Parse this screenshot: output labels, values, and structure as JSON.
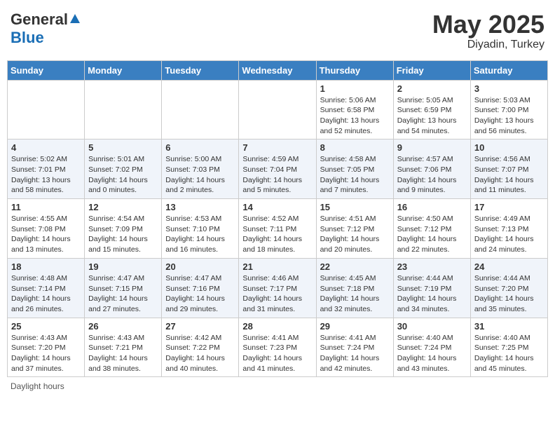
{
  "header": {
    "logo_general": "General",
    "logo_blue": "Blue",
    "month": "May 2025",
    "location": "Diyadin, Turkey"
  },
  "days_of_week": [
    "Sunday",
    "Monday",
    "Tuesday",
    "Wednesday",
    "Thursday",
    "Friday",
    "Saturday"
  ],
  "footer": {
    "daylight_hours": "Daylight hours"
  },
  "weeks": [
    [
      {
        "day": "",
        "sunrise": "",
        "sunset": "",
        "daylight": ""
      },
      {
        "day": "",
        "sunrise": "",
        "sunset": "",
        "daylight": ""
      },
      {
        "day": "",
        "sunrise": "",
        "sunset": "",
        "daylight": ""
      },
      {
        "day": "",
        "sunrise": "",
        "sunset": "",
        "daylight": ""
      },
      {
        "day": "1",
        "sunrise": "Sunrise: 5:06 AM",
        "sunset": "Sunset: 6:58 PM",
        "daylight": "Daylight: 13 hours and 52 minutes."
      },
      {
        "day": "2",
        "sunrise": "Sunrise: 5:05 AM",
        "sunset": "Sunset: 6:59 PM",
        "daylight": "Daylight: 13 hours and 54 minutes."
      },
      {
        "day": "3",
        "sunrise": "Sunrise: 5:03 AM",
        "sunset": "Sunset: 7:00 PM",
        "daylight": "Daylight: 13 hours and 56 minutes."
      }
    ],
    [
      {
        "day": "4",
        "sunrise": "Sunrise: 5:02 AM",
        "sunset": "Sunset: 7:01 PM",
        "daylight": "Daylight: 13 hours and 58 minutes."
      },
      {
        "day": "5",
        "sunrise": "Sunrise: 5:01 AM",
        "sunset": "Sunset: 7:02 PM",
        "daylight": "Daylight: 14 hours and 0 minutes."
      },
      {
        "day": "6",
        "sunrise": "Sunrise: 5:00 AM",
        "sunset": "Sunset: 7:03 PM",
        "daylight": "Daylight: 14 hours and 2 minutes."
      },
      {
        "day": "7",
        "sunrise": "Sunrise: 4:59 AM",
        "sunset": "Sunset: 7:04 PM",
        "daylight": "Daylight: 14 hours and 5 minutes."
      },
      {
        "day": "8",
        "sunrise": "Sunrise: 4:58 AM",
        "sunset": "Sunset: 7:05 PM",
        "daylight": "Daylight: 14 hours and 7 minutes."
      },
      {
        "day": "9",
        "sunrise": "Sunrise: 4:57 AM",
        "sunset": "Sunset: 7:06 PM",
        "daylight": "Daylight: 14 hours and 9 minutes."
      },
      {
        "day": "10",
        "sunrise": "Sunrise: 4:56 AM",
        "sunset": "Sunset: 7:07 PM",
        "daylight": "Daylight: 14 hours and 11 minutes."
      }
    ],
    [
      {
        "day": "11",
        "sunrise": "Sunrise: 4:55 AM",
        "sunset": "Sunset: 7:08 PM",
        "daylight": "Daylight: 14 hours and 13 minutes."
      },
      {
        "day": "12",
        "sunrise": "Sunrise: 4:54 AM",
        "sunset": "Sunset: 7:09 PM",
        "daylight": "Daylight: 14 hours and 15 minutes."
      },
      {
        "day": "13",
        "sunrise": "Sunrise: 4:53 AM",
        "sunset": "Sunset: 7:10 PM",
        "daylight": "Daylight: 14 hours and 16 minutes."
      },
      {
        "day": "14",
        "sunrise": "Sunrise: 4:52 AM",
        "sunset": "Sunset: 7:11 PM",
        "daylight": "Daylight: 14 hours and 18 minutes."
      },
      {
        "day": "15",
        "sunrise": "Sunrise: 4:51 AM",
        "sunset": "Sunset: 7:12 PM",
        "daylight": "Daylight: 14 hours and 20 minutes."
      },
      {
        "day": "16",
        "sunrise": "Sunrise: 4:50 AM",
        "sunset": "Sunset: 7:12 PM",
        "daylight": "Daylight: 14 hours and 22 minutes."
      },
      {
        "day": "17",
        "sunrise": "Sunrise: 4:49 AM",
        "sunset": "Sunset: 7:13 PM",
        "daylight": "Daylight: 14 hours and 24 minutes."
      }
    ],
    [
      {
        "day": "18",
        "sunrise": "Sunrise: 4:48 AM",
        "sunset": "Sunset: 7:14 PM",
        "daylight": "Daylight: 14 hours and 26 minutes."
      },
      {
        "day": "19",
        "sunrise": "Sunrise: 4:47 AM",
        "sunset": "Sunset: 7:15 PM",
        "daylight": "Daylight: 14 hours and 27 minutes."
      },
      {
        "day": "20",
        "sunrise": "Sunrise: 4:47 AM",
        "sunset": "Sunset: 7:16 PM",
        "daylight": "Daylight: 14 hours and 29 minutes."
      },
      {
        "day": "21",
        "sunrise": "Sunrise: 4:46 AM",
        "sunset": "Sunset: 7:17 PM",
        "daylight": "Daylight: 14 hours and 31 minutes."
      },
      {
        "day": "22",
        "sunrise": "Sunrise: 4:45 AM",
        "sunset": "Sunset: 7:18 PM",
        "daylight": "Daylight: 14 hours and 32 minutes."
      },
      {
        "day": "23",
        "sunrise": "Sunrise: 4:44 AM",
        "sunset": "Sunset: 7:19 PM",
        "daylight": "Daylight: 14 hours and 34 minutes."
      },
      {
        "day": "24",
        "sunrise": "Sunrise: 4:44 AM",
        "sunset": "Sunset: 7:20 PM",
        "daylight": "Daylight: 14 hours and 35 minutes."
      }
    ],
    [
      {
        "day": "25",
        "sunrise": "Sunrise: 4:43 AM",
        "sunset": "Sunset: 7:20 PM",
        "daylight": "Daylight: 14 hours and 37 minutes."
      },
      {
        "day": "26",
        "sunrise": "Sunrise: 4:43 AM",
        "sunset": "Sunset: 7:21 PM",
        "daylight": "Daylight: 14 hours and 38 minutes."
      },
      {
        "day": "27",
        "sunrise": "Sunrise: 4:42 AM",
        "sunset": "Sunset: 7:22 PM",
        "daylight": "Daylight: 14 hours and 40 minutes."
      },
      {
        "day": "28",
        "sunrise": "Sunrise: 4:41 AM",
        "sunset": "Sunset: 7:23 PM",
        "daylight": "Daylight: 14 hours and 41 minutes."
      },
      {
        "day": "29",
        "sunrise": "Sunrise: 4:41 AM",
        "sunset": "Sunset: 7:24 PM",
        "daylight": "Daylight: 14 hours and 42 minutes."
      },
      {
        "day": "30",
        "sunrise": "Sunrise: 4:40 AM",
        "sunset": "Sunset: 7:24 PM",
        "daylight": "Daylight: 14 hours and 43 minutes."
      },
      {
        "day": "31",
        "sunrise": "Sunrise: 4:40 AM",
        "sunset": "Sunset: 7:25 PM",
        "daylight": "Daylight: 14 hours and 45 minutes."
      }
    ]
  ]
}
